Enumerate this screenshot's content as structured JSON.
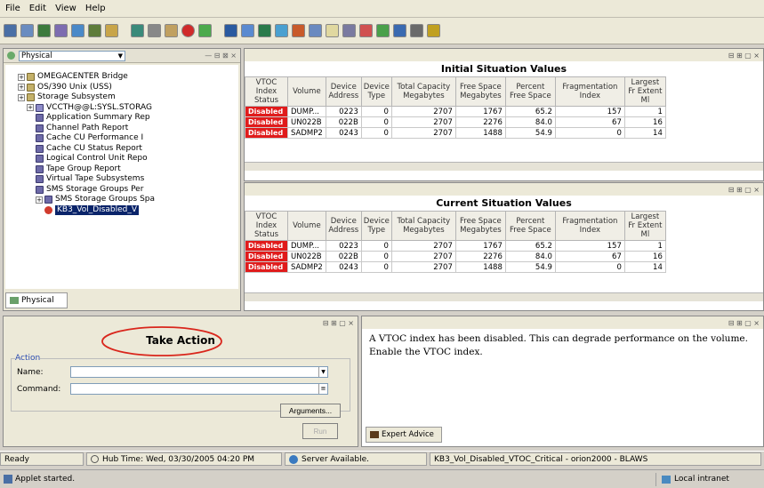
{
  "menu": {
    "file": "File",
    "edit": "Edit",
    "view": "View",
    "help": "Help"
  },
  "navigator": {
    "view_selector": "Physical",
    "tab_label": "Physical",
    "tree": [
      {
        "label": "OMEGACENTER Bridge",
        "level": 1,
        "icon": "folder"
      },
      {
        "label": "OS/390 Unix (USS)",
        "level": 1,
        "icon": "folder"
      },
      {
        "label": "Storage Subsystem",
        "level": 1,
        "icon": "folder"
      },
      {
        "label": "VCCTH@@L:SYSL.STORAG",
        "level": 2,
        "icon": "node"
      },
      {
        "label": "Application Summary Rep",
        "level": 3,
        "icon": "report"
      },
      {
        "label": "Channel Path Report",
        "level": 3,
        "icon": "report"
      },
      {
        "label": "Cache CU Performance I",
        "level": 3,
        "icon": "report"
      },
      {
        "label": "Cache CU Status Report",
        "level": 3,
        "icon": "report"
      },
      {
        "label": "Logical Control Unit Repo",
        "level": 3,
        "icon": "report"
      },
      {
        "label": "Tape Group Report",
        "level": 3,
        "icon": "report"
      },
      {
        "label": "Virtual Tape Subsystems",
        "level": 3,
        "icon": "report"
      },
      {
        "label": "SMS Storage Groups Per",
        "level": 3,
        "icon": "report"
      },
      {
        "label": "SMS Storage Groups Spa",
        "level": 3,
        "icon": "report"
      },
      {
        "label": "KB3_Vol_Disabled_V",
        "level": 4,
        "icon": "special"
      }
    ]
  },
  "initial_table": {
    "title": "Initial Situation Values",
    "headers": [
      "VTOC Index Status",
      "Volume",
      "Device Address",
      "Device Type",
      "Total Capacity Megabytes",
      "Free Space Megabytes",
      "Percent Free Space",
      "Fragmentation Index",
      "Largest Fr Extent Ml"
    ],
    "rows": [
      [
        "Disabled",
        "DUMP...",
        "0223",
        "0",
        "2707",
        "1767",
        "65.2",
        "157",
        "1"
      ],
      [
        "Disabled",
        "UN022B",
        "022B",
        "0",
        "2707",
        "2276",
        "84.0",
        "67",
        "16"
      ],
      [
        "Disabled",
        "SADMP2",
        "0243",
        "0",
        "2707",
        "1488",
        "54.9",
        "0",
        "14"
      ]
    ]
  },
  "current_table": {
    "title": "Current Situation Values",
    "headers": [
      "VTOC Index Status",
      "Volume",
      "Device Address",
      "Device Type",
      "Total Capacity Megabytes",
      "Free Space Megabytes",
      "Percent Free Space",
      "Fragmentation Index",
      "Largest Fr Extent Ml"
    ],
    "rows": [
      [
        "Disabled",
        "DUMP...",
        "0223",
        "0",
        "2707",
        "1767",
        "65.2",
        "157",
        "1"
      ],
      [
        "Disabled",
        "UN022B",
        "022B",
        "0",
        "2707",
        "2276",
        "84.0",
        "67",
        "16"
      ],
      [
        "Disabled",
        "SADMP2",
        "0243",
        "0",
        "2707",
        "1488",
        "54.9",
        "0",
        "14"
      ]
    ]
  },
  "take_action": {
    "title": "Take Action",
    "group_label": "Action",
    "name_label": "Name:",
    "name_value": "",
    "command_label": "Command:",
    "command_value": "",
    "arguments_button": "Arguments...",
    "run_button": "Run"
  },
  "expert_advice": {
    "text": "A VTOC index has been disabled. This can degrade performance on the volume. Enable the VTOC index.",
    "tab_label": "Expert Advice"
  },
  "status_bar": {
    "ready": "Ready",
    "hub_time": "Hub Time: Wed, 03/30/2005 04:20 PM",
    "server": "Server Available.",
    "situation": "KB3_Vol_Disabled_VTOC_Critical - orion2000 - BLAWS"
  },
  "browser_bar": {
    "applet": "Applet started.",
    "zone": "Local intranet"
  },
  "colors": {
    "disabled": "#e01b1b",
    "selection": "#0a246a",
    "annotation_circle": "#d9261c"
  }
}
